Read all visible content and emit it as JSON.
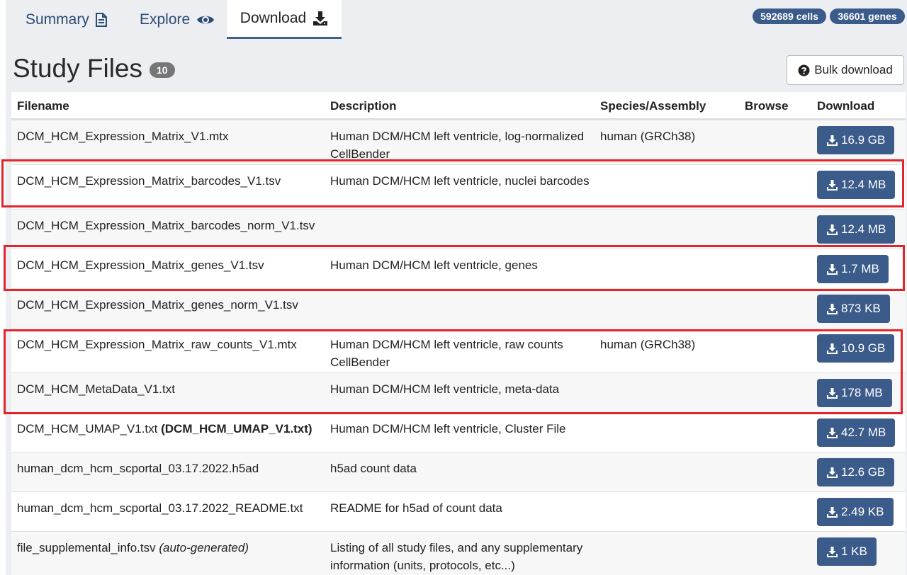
{
  "nav": {
    "tabs": [
      {
        "label": "Summary",
        "icon": "document-icon"
      },
      {
        "label": "Explore",
        "icon": "eye-icon"
      },
      {
        "label": "Download",
        "icon": "download-icon"
      }
    ],
    "cells_badge": "592689 cells",
    "genes_badge": "36601 genes"
  },
  "header": {
    "title": "Study Files",
    "count": "10",
    "bulk_label": "Bulk download"
  },
  "table": {
    "columns": [
      "Filename",
      "Description",
      "Species/Assembly",
      "Browse",
      "Download"
    ],
    "rows": [
      {
        "file": "DCM_HCM_Expression_Matrix_V1.mtx",
        "desc": "Human DCM/HCM left ventricle, log-normalized CellBender",
        "species": "human (GRCh38)",
        "size": "16.9 GB"
      },
      {
        "file": "DCM_HCM_Expression_Matrix_barcodes_V1.tsv",
        "desc": "Human DCM/HCM left ventricle, nuclei barcodes",
        "species": "",
        "size": "12.4 MB"
      },
      {
        "file": "DCM_HCM_Expression_Matrix_barcodes_norm_V1.tsv",
        "desc": "",
        "species": "",
        "size": "12.4 MB"
      },
      {
        "file": "DCM_HCM_Expression_Matrix_genes_V1.tsv",
        "desc": "Human DCM/HCM left ventricle, genes",
        "species": "",
        "size": "1.7 MB"
      },
      {
        "file": "DCM_HCM_Expression_Matrix_genes_norm_V1.tsv",
        "desc": "",
        "species": "",
        "size": "873 KB"
      },
      {
        "file": "DCM_HCM_Expression_Matrix_raw_counts_V1.mtx",
        "desc": "Human DCM/HCM left ventricle, raw counts CellBender",
        "species": "human (GRCh38)",
        "size": "10.9 GB"
      },
      {
        "file": "DCM_HCM_MetaData_V1.txt",
        "desc": "Human DCM/HCM left ventricle, meta-data",
        "species": "",
        "size": "178 MB"
      },
      {
        "file": "DCM_HCM_UMAP_V1.txt",
        "file_bold": "(DCM_HCM_UMAP_V1.txt)",
        "desc": "Human DCM/HCM left ventricle, Cluster File",
        "species": "",
        "size": "42.7 MB"
      },
      {
        "file": "human_dcm_hcm_scportal_03.17.2022.h5ad",
        "desc": "h5ad count data",
        "species": "",
        "size": "12.6 GB"
      },
      {
        "file": "human_dcm_hcm_scportal_03.17.2022_README.txt",
        "desc": "README for h5ad of count data",
        "species": "",
        "size": "2.49 KB"
      },
      {
        "file": "file_supplemental_info.tsv",
        "file_italic": "(auto-generated)",
        "desc": "Listing of all study files, and any supplementary information (units, protocols, etc...)",
        "species": "",
        "size": "1 KB"
      }
    ]
  },
  "colors": {
    "accent": "#3b5b8b",
    "highlight": "#e0252b"
  }
}
